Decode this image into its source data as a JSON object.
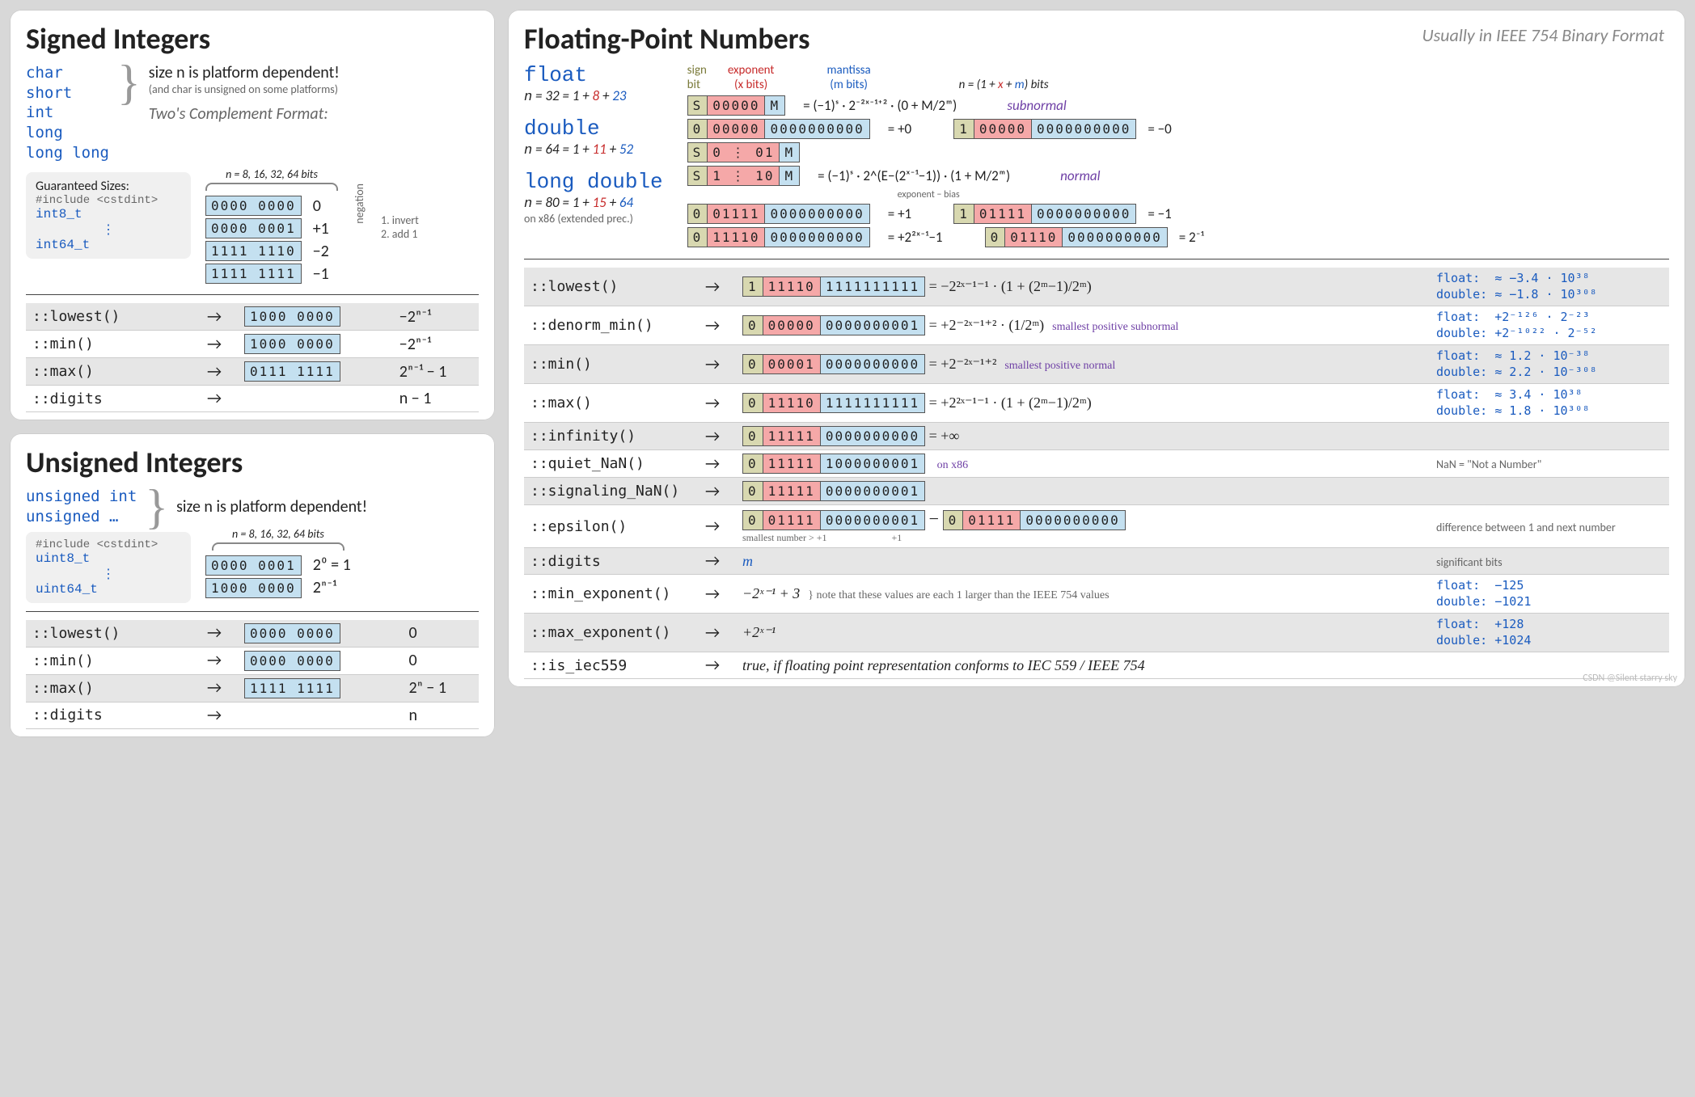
{
  "signed": {
    "title": "Signed Integers",
    "types": [
      "char",
      "short",
      "int",
      "long",
      "long long"
    ],
    "dep_note_1": "size n is platform dependent!",
    "dep_note_2": "(and char is unsigned on some platforms)",
    "format_label": "Two's Complement Format:",
    "bits_label": "n = 8, 16, 32, 64 bits",
    "guaranteed_label": "Guaranteed Sizes:",
    "include": "#include <cstdint>",
    "fixed_lo": "int8_t",
    "fixed_hi": "int64_t",
    "examples": [
      {
        "bits": "0000 0000",
        "val": "0"
      },
      {
        "bits": "0000 0001",
        "val": "+1"
      },
      {
        "bits": "1111 1110",
        "val": "−2"
      },
      {
        "bits": "1111 1111",
        "val": "−1"
      }
    ],
    "neg_hint": "negation",
    "neg_steps": [
      "1. invert",
      "2. add 1"
    ],
    "limits": [
      {
        "fn": "::lowest()",
        "bits": "1000 0000",
        "val": "−2ⁿ⁻¹",
        "alt": true
      },
      {
        "fn": "::min()",
        "bits": "1000 0000",
        "val": "−2ⁿ⁻¹",
        "alt": false
      },
      {
        "fn": "::max()",
        "bits": "0111 1111",
        "val": "2ⁿ⁻¹ − 1",
        "alt": true
      },
      {
        "fn": "::digits",
        "bits": "",
        "val": "n − 1",
        "alt": false
      }
    ]
  },
  "unsigned": {
    "title": "Unsigned Integers",
    "types": [
      "unsigned int",
      "unsigned …"
    ],
    "dep_note": "size n is platform dependent!",
    "bits_label": "n = 8, 16, 32, 64 bits",
    "include": "#include <cstdint>",
    "fixed_lo": "uint8_t",
    "fixed_hi": "uint64_t",
    "examples": [
      {
        "bits": "0000 0001",
        "val": "2⁰ = 1"
      },
      {
        "bits": "1000 0000",
        "val": "2ⁿ⁻¹"
      }
    ],
    "limits": [
      {
        "fn": "::lowest()",
        "bits": "0000 0000",
        "val": "0",
        "alt": true
      },
      {
        "fn": "::min()",
        "bits": "0000 0000",
        "val": "0",
        "alt": false
      },
      {
        "fn": "::max()",
        "bits": "1111 1111",
        "val": "2ⁿ − 1",
        "alt": true
      },
      {
        "fn": "::digits",
        "bits": "",
        "val": "n",
        "alt": false
      }
    ]
  },
  "fp": {
    "title": "Floating-Point Numbers",
    "subtitle": "Usually in IEEE 754 Binary Format",
    "legend": {
      "sign": "sign\nbit",
      "exp": "exponent\n(x bits)",
      "mant": "mantissa\n(m bits)"
    },
    "n_formula": "n = (1 + x + m) bits",
    "types": [
      {
        "name": "float",
        "n": "n = 32 = 1 + 8 + 23",
        "nbits": {
          "x": "8",
          "m": "23"
        }
      },
      {
        "name": "double",
        "n": "n = 64 = 1 + 11 + 52",
        "nbits": {
          "x": "11",
          "m": "52"
        }
      },
      {
        "name": "long double",
        "n": "n = 80 = 1 + 15 + 64",
        "note": "on x86 (extended prec.)",
        "nbits": {
          "x": "15",
          "m": "64"
        }
      }
    ],
    "subnormal_label": "subnormal",
    "normal_label": "normal",
    "examples": [
      {
        "s": "S",
        "e": "00000",
        "m": "M",
        "eq": "= (−1)ˢ · 2⁻²ˣ⁻¹⁺² · (0 + M/2ᵐ)",
        "tag": "subnormal"
      },
      {
        "s": "0",
        "e": "00000",
        "m": "0000000000",
        "eq": "= +0",
        "pair": {
          "s": "1",
          "e": "00000",
          "m": "0000000000",
          "eq": "= −0"
        }
      },
      {
        "s": "S",
        "e": "0 ⋮ 01",
        "m": "M",
        "eq": ""
      },
      {
        "s": "S",
        "e": "1 ⋮ 10",
        "m": "M",
        "eq": "= (−1)ˢ · 2^(E−(2ˣ⁻¹−1)) · (1 + M/2ᵐ)",
        "tag": "normal",
        "sub": "exponent − bias"
      },
      {
        "s": "0",
        "e": "01111",
        "m": "0000000000",
        "eq": "= +1",
        "pair": {
          "s": "1",
          "e": "01111",
          "m": "0000000000",
          "eq": "= −1"
        }
      },
      {
        "s": "0",
        "e": "11110",
        "m": "0000000000",
        "eq": "= +2²ˣ⁻¹−1",
        "pair": {
          "s": "0",
          "e": "01110",
          "m": "0000000000",
          "eq": "= 2⁻¹"
        }
      }
    ],
    "limits": [
      {
        "fn": "::lowest()",
        "s": "1",
        "e": "11110",
        "m": "1111111111",
        "formula": "= −2²ˣ⁻¹⁻¹ · (1 + (2ᵐ−1)/2ᵐ)",
        "vals": {
          "float": "≈ −3.4 · 10³⁸",
          "double": "≈ −1.8 · 10³⁰⁸"
        },
        "alt": true
      },
      {
        "fn": "::denorm_min()",
        "s": "0",
        "e": "00000",
        "m": "0000000001",
        "formula": "= +2⁻²ˣ⁻¹⁺² · (1/2ᵐ)",
        "note": "smallest positive subnormal",
        "vals": {
          "float": "+2⁻¹²⁶ · 2⁻²³",
          "double": "+2⁻¹⁰²² · 2⁻⁵²"
        },
        "alt": false
      },
      {
        "fn": "::min()",
        "s": "0",
        "e": "00001",
        "m": "0000000000",
        "formula": "= +2⁻²ˣ⁻¹⁺²",
        "note": "smallest positive normal",
        "vals": {
          "float": "≈ 1.2 · 10⁻³⁸",
          "double": "≈ 2.2 · 10⁻³⁰⁸"
        },
        "alt": true
      },
      {
        "fn": "::max()",
        "s": "0",
        "e": "11110",
        "m": "1111111111",
        "formula": "= +2²ˣ⁻¹⁻¹ · (1 + (2ᵐ−1)/2ᵐ)",
        "vals": {
          "float": "≈ 3.4 · 10³⁸",
          "double": "≈ 1.8 · 10³⁰⁸"
        },
        "alt": false
      },
      {
        "fn": "::infinity()",
        "s": "0",
        "e": "11111",
        "m": "0000000000",
        "formula": "= +∞",
        "alt": true
      },
      {
        "fn": "::quiet_NaN()",
        "s": "0",
        "e": "11111",
        "m": "1000000001",
        "formula": "",
        "note": "on x86",
        "rightnote": "NaN = \"Not a Number\"",
        "alt": false
      },
      {
        "fn": "::signaling_NaN()",
        "s": "0",
        "e": "11111",
        "m": "0000000001",
        "formula": "",
        "alt": true
      },
      {
        "fn": "::epsilon()",
        "eps_a": {
          "s": "0",
          "e": "01111",
          "m": "0000000001"
        },
        "eps_b": {
          "s": "0",
          "e": "01111",
          "m": "0000000000"
        },
        "eps_a_label": "smallest number > +1",
        "eps_b_label": "+1",
        "rightnote": "difference between 1 and next number",
        "alt": false
      },
      {
        "fn": "::digits",
        "plain": "m",
        "rightnote": "significant bits",
        "alt": true
      },
      {
        "fn": "::min_exponent()",
        "plain": "−2ˣ⁻¹ + 3",
        "exp_note": "note that these values are each 1 larger than the IEEE 754 values",
        "vals": {
          "float": "−125",
          "double": "−1021"
        },
        "alt": false
      },
      {
        "fn": "::max_exponent()",
        "plain": "+2ˣ⁻¹",
        "vals": {
          "float": "+128",
          "double": "+1024"
        },
        "alt": true
      },
      {
        "fn": "::is_iec559",
        "plain": "true, if floating point representation conforms to IEC 559 / IEEE 754",
        "alt": false
      }
    ]
  },
  "watermark": "CSDN @Silent starry sky"
}
